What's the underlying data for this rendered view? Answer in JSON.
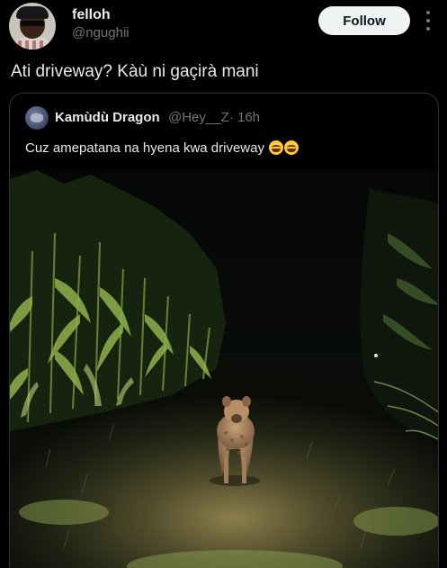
{
  "author": {
    "display_name": "felloh",
    "handle": "@ngughii"
  },
  "actions": {
    "follow_label": "Follow"
  },
  "post": {
    "text": "Ati driveway? Kàù ni gaçirà mani"
  },
  "quoted": {
    "display_name": "Kamùdù Dragon",
    "handle": "@Hey__Z",
    "separator": "·",
    "time": "16h",
    "text": "Cuz amepatana na hyena kwa driveway",
    "emojis": [
      "grinning-squinting-face",
      "grinning-squinting-face"
    ]
  },
  "icons": [
    "more-options-icon",
    "avatar",
    "emoji"
  ],
  "colors": {
    "background": "#000000",
    "text": "#e7e9ea",
    "secondary_text": "#71767b",
    "border": "#2f3336",
    "button_bg": "#eff3f4",
    "button_text": "#0f1419"
  }
}
